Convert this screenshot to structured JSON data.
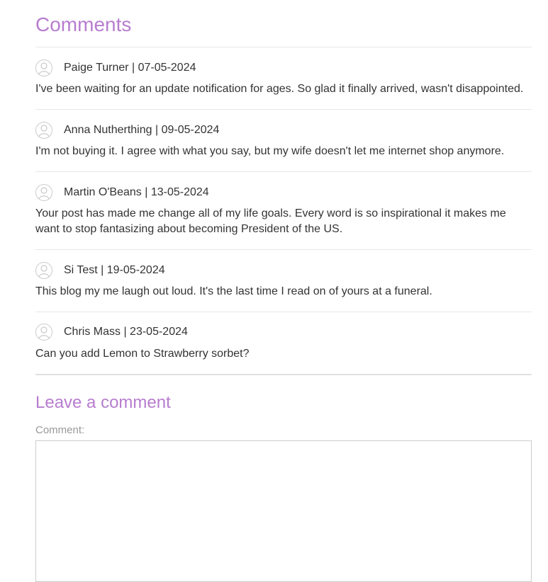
{
  "comments_section": {
    "title": "Comments",
    "items": [
      {
        "author": "Paige Turner",
        "date": "07-05-2024",
        "meta": "Paige Turner | 07-05-2024",
        "text": "I've been waiting for an update notification for ages. So glad it finally arrived, wasn't disappointed."
      },
      {
        "author": "Anna Nutherthing",
        "date": "09-05-2024",
        "meta": "Anna Nutherthing | 09-05-2024",
        "text": "I'm not buying it. I agree with what you say, but my wife doesn't let me internet shop anymore."
      },
      {
        "author": "Martin O'Beans",
        "date": "13-05-2024",
        "meta": "Martin O'Beans | 13-05-2024",
        "text": "Your post has made me change all of my life goals. Every word is so inspirational it makes me want to stop fantasizing about becoming President of the US."
      },
      {
        "author": "Si Test",
        "date": "19-05-2024",
        "meta": "Si Test | 19-05-2024",
        "text": "This blog my me laugh out loud. It's the last time I read on of yours at a funeral."
      },
      {
        "author": "Chris Mass",
        "date": "23-05-2024",
        "meta": "Chris Mass | 23-05-2024",
        "text": "Can you add Lemon to Strawberry sorbet?"
      }
    ]
  },
  "leave_comment": {
    "title": "Leave a comment",
    "comment_label": "Comment:",
    "comment_value": ""
  },
  "icons": {
    "avatar": "user-avatar-icon"
  },
  "colors": {
    "accent": "#b77dcf",
    "text": "#333333",
    "muted": "#999999",
    "rule": "#e8e8e8"
  }
}
